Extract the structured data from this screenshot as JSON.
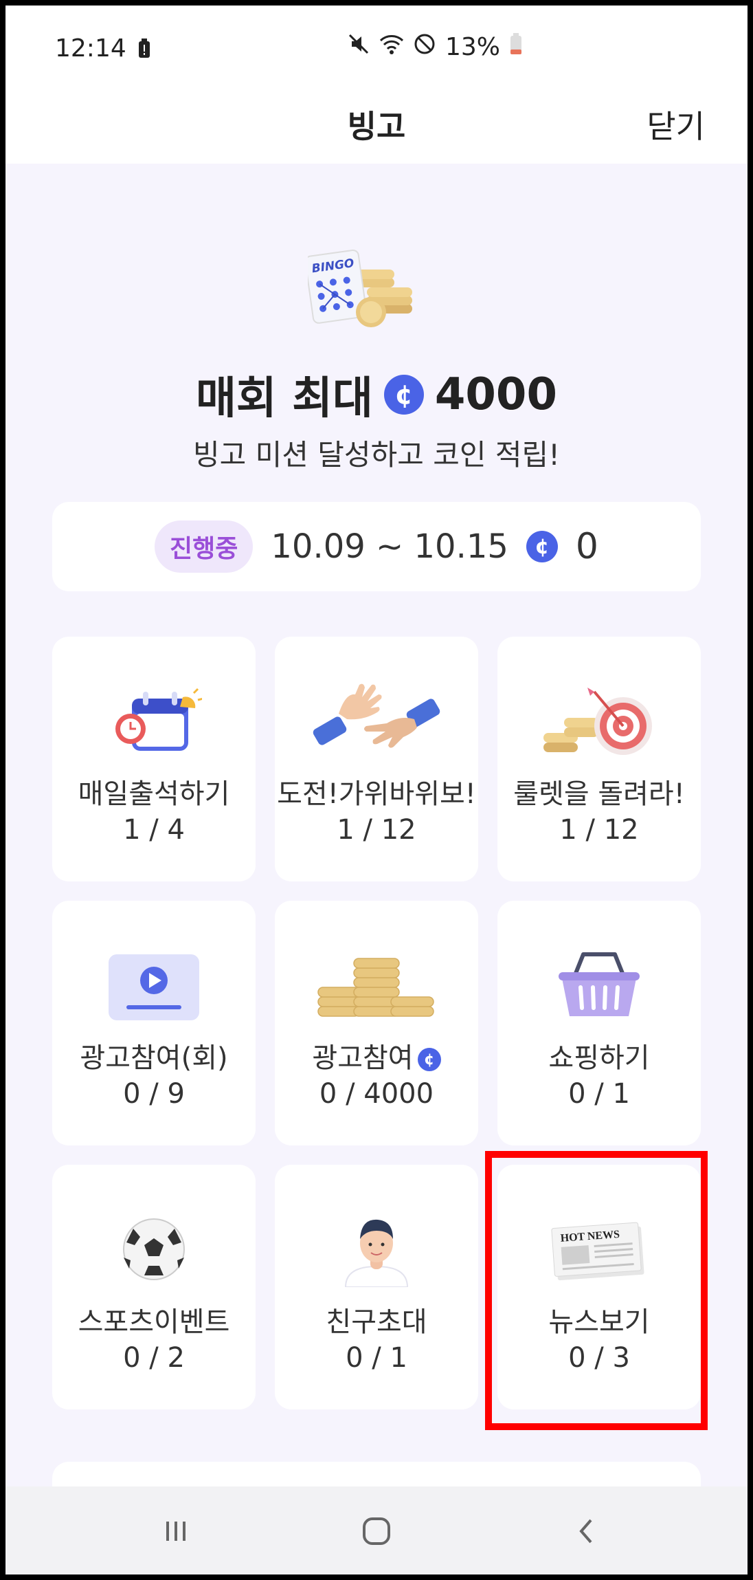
{
  "status_bar": {
    "time": "12:14",
    "battery_percent": "13%",
    "icons": [
      "battery-alert-icon",
      "mute-icon",
      "wifi-icon",
      "dnd-icon",
      "battery-icon"
    ]
  },
  "header": {
    "title": "빙고",
    "close_label": "닫기"
  },
  "hero": {
    "illustration_text": "BINGO",
    "title_prefix": "매회 최대",
    "coin_symbol": "¢",
    "title_amount": "4000",
    "subtitle": "빙고 미션 달성하고 코인 적립!"
  },
  "period": {
    "status": "진행중",
    "range": "10.09 ~ 10.15",
    "coin_symbol": "¢",
    "coins": "0"
  },
  "missions": [
    {
      "label": "매일출석하기",
      "count": "1 / 4",
      "icon": "calendar-icon"
    },
    {
      "label": "도전!가위바위보!",
      "count": "1 / 12",
      "icon": "rock-paper-scissors-icon"
    },
    {
      "label": "룰렛을 돌려라!",
      "count": "1 / 12",
      "icon": "target-icon"
    },
    {
      "label": "광고참여(회)",
      "count": "0 / 9",
      "icon": "video-play-icon"
    },
    {
      "label": "광고참여",
      "count": "0 / 4000",
      "icon": "coin-stack-icon",
      "coin_symbol": "¢"
    },
    {
      "label": "쇼핑하기",
      "count": "0 / 1",
      "icon": "shopping-basket-icon"
    },
    {
      "label": "스포츠이벤트",
      "count": "0 / 2",
      "icon": "soccer-ball-icon"
    },
    {
      "label": "친구초대",
      "count": "0 / 1",
      "icon": "person-avatar-icon"
    },
    {
      "label": "뉴스보기",
      "count": "0 / 3",
      "icon": "newspaper-icon",
      "icon_text": "HOT NEWS"
    }
  ],
  "colors": {
    "accent": "#4a63e6",
    "pill_bg": "#efe7fb",
    "pill_text": "#9a4fd8",
    "page_bg": "#f6f4fd",
    "highlight": "#ff0000"
  }
}
